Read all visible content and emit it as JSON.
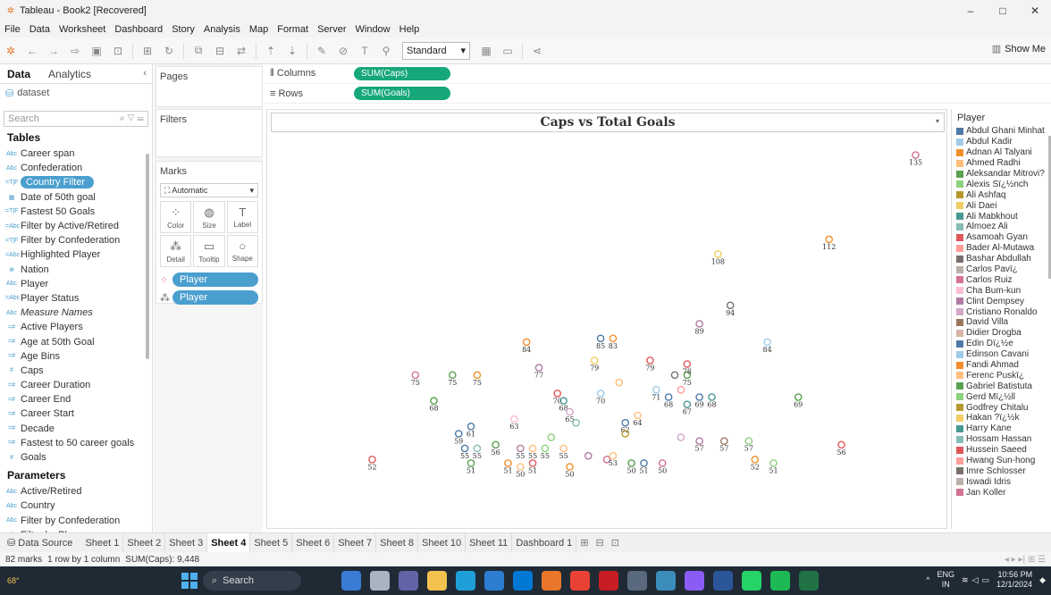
{
  "window": {
    "title": "Tableau - Book2 [Recovered]",
    "controls": [
      "–",
      "□",
      "✕"
    ]
  },
  "menu": [
    "File",
    "Data",
    "Worksheet",
    "Dashboard",
    "Story",
    "Analysis",
    "Map",
    "Format",
    "Server",
    "Window",
    "Help"
  ],
  "toolbar": {
    "fit_value": "Standard",
    "show_me": "Show Me"
  },
  "left_pane": {
    "tab_data": "Data",
    "tab_analytics": "Analytics",
    "datasource": "dataset",
    "search_placeholder": "Search",
    "tables_header": "Tables",
    "fields": [
      {
        "type": "Abc",
        "name": "Career span"
      },
      {
        "type": "Abc",
        "name": "Confederation"
      },
      {
        "type": "=T|F",
        "name": "Country Filter",
        "selected": true
      },
      {
        "type": "▦",
        "name": "Date of 50th goal"
      },
      {
        "type": "=T|F",
        "name": "Fastest 50 Goals"
      },
      {
        "type": "=Abc",
        "name": "Filter by Active/Retired"
      },
      {
        "type": "=T|F",
        "name": "Filter by Confederation"
      },
      {
        "type": "=Abc",
        "name": "Highlighted Player"
      },
      {
        "type": "⊕",
        "name": "Nation"
      },
      {
        "type": "Abc",
        "name": "Player"
      },
      {
        "type": "=Abc",
        "name": "Player Status"
      },
      {
        "type": "Abc",
        "name": "Measure Names",
        "italic": true
      },
      {
        "type": "=#",
        "name": "Active Players"
      },
      {
        "type": "=#",
        "name": "Age at 50th Goal"
      },
      {
        "type": "=#",
        "name": "Age Bins"
      },
      {
        "type": "#",
        "name": "Caps"
      },
      {
        "type": "=#",
        "name": "Career Duration"
      },
      {
        "type": "=#",
        "name": "Career End"
      },
      {
        "type": "=#",
        "name": "Career Start"
      },
      {
        "type": "=#",
        "name": "Decade"
      },
      {
        "type": "=#",
        "name": "Fastest to 50 career goals"
      },
      {
        "type": "#",
        "name": "Goals"
      }
    ],
    "parameters_header": "Parameters",
    "parameters": [
      {
        "type": "Abc",
        "name": "Active/Retired"
      },
      {
        "type": "Abc",
        "name": "Country"
      },
      {
        "type": "Abc",
        "name": "Filter by Confederation"
      },
      {
        "type": "#",
        "name": "Filter by Players"
      }
    ]
  },
  "cards": {
    "pages": "Pages",
    "filters": "Filters",
    "marks": "Marks",
    "marks_type": "Automatic",
    "mark_buttons": [
      {
        "icon": "color-icon",
        "glyph": "⁘",
        "label": "Color"
      },
      {
        "icon": "size-icon",
        "glyph": "◍",
        "label": "Size"
      },
      {
        "icon": "label-icon",
        "glyph": "T",
        "label": "Label"
      },
      {
        "icon": "detail-icon",
        "glyph": "⁂",
        "label": "Detail"
      },
      {
        "icon": "tooltip-icon",
        "glyph": "▭",
        "label": "Tooltip"
      },
      {
        "icon": "shape-icon",
        "glyph": "○",
        "label": "Shape"
      }
    ],
    "mark_pills": [
      "Player",
      "Player"
    ]
  },
  "shelves": {
    "columns_label": "Columns",
    "columns_pill": "SUM(Caps)",
    "rows_label": "Rows",
    "rows_pill": "SUM(Goals)"
  },
  "legend": {
    "title": "Player",
    "items": [
      {
        "name": "Abdul Ghani Minhat",
        "color": "#4e79a7"
      },
      {
        "name": "Abdul Kadir",
        "color": "#a0cbe8"
      },
      {
        "name": "Adnan Al Talyani",
        "color": "#f28e2b"
      },
      {
        "name": "Ahmed Radhi",
        "color": "#ffbe7d"
      },
      {
        "name": "Aleksandar Mitrovi?",
        "color": "#59a14f"
      },
      {
        "name": "Alexis Sï¿½nch",
        "color": "#8cd17d"
      },
      {
        "name": "Ali Ashfaq",
        "color": "#b6992d"
      },
      {
        "name": "Ali Daei",
        "color": "#f1ce63"
      },
      {
        "name": "Ali Mabkhout",
        "color": "#499894"
      },
      {
        "name": "Almoez Ali",
        "color": "#86bcb6"
      },
      {
        "name": "Asamoah Gyan",
        "color": "#e15759"
      },
      {
        "name": "Bader Al-Mutawa",
        "color": "#ff9d9a"
      },
      {
        "name": "Bashar Abdullah",
        "color": "#79706e"
      },
      {
        "name": "Carlos Pavï¿",
        "color": "#bab0ac"
      },
      {
        "name": "Carlos Ruiz",
        "color": "#d37295"
      },
      {
        "name": "Cha Bum-kun",
        "color": "#fabfd2"
      },
      {
        "name": "Clint Dempsey",
        "color": "#b07aa1"
      },
      {
        "name": "Cristiano Ronaldo",
        "color": "#d4a6c8"
      },
      {
        "name": "David Villa",
        "color": "#9d7660"
      },
      {
        "name": "Didier Drogba",
        "color": "#d7b5a6"
      },
      {
        "name": "Edin Dï¿½e",
        "color": "#4e79a7"
      },
      {
        "name": "Edinson Cavani",
        "color": "#a0cbe8"
      },
      {
        "name": "Fandi Ahmad",
        "color": "#f28e2b"
      },
      {
        "name": "Ferenc Puskï¿",
        "color": "#ffbe7d"
      },
      {
        "name": "Gabriel Batistuta",
        "color": "#59a14f"
      },
      {
        "name": "Gerd Mï¿½ll",
        "color": "#8cd17d"
      },
      {
        "name": "Godfrey Chitalu",
        "color": "#b6992d"
      },
      {
        "name": "Hakan ?ï¿½k",
        "color": "#f1ce63"
      },
      {
        "name": "Harry Kane",
        "color": "#499894"
      },
      {
        "name": "Hossam Hassan",
        "color": "#86bcb6"
      },
      {
        "name": "Hussein Saeed",
        "color": "#e15759"
      },
      {
        "name": "Hwang Sun-hong",
        "color": "#ff9d9a"
      },
      {
        "name": "Imre Schlosser",
        "color": "#79706e"
      },
      {
        "name": "Iswadi Idris",
        "color": "#bab0ac"
      },
      {
        "name": "Jan Koller",
        "color": "#d37295"
      }
    ]
  },
  "sheet_tabs": {
    "data_source": "Data Source",
    "tabs": [
      "Sheet 1",
      "Sheet 2",
      "Sheet 3",
      "Sheet 4",
      "Sheet 5",
      "Sheet 6",
      "Sheet 7",
      "Sheet 8",
      "Sheet 10",
      "Sheet 11",
      "Dashboard 1"
    ],
    "active": "Sheet 4"
  },
  "status": {
    "marks": "82 marks",
    "rows_cols": "1 row by 1 column",
    "sum": "SUM(Caps): 9,448"
  },
  "taskbar": {
    "weather": "68°",
    "search": "Search",
    "lang": "ENG",
    "region": "IN",
    "time": "10:56 PM",
    "date": "12/1/2024"
  },
  "chart_data": {
    "type": "scatter",
    "title": "Caps vs Total Goals",
    "xlabel": "",
    "ylabel": "",
    "show_axes": false,
    "grid": false,
    "xlim": [
      100,
      210
    ],
    "ylim": [
      45,
      140
    ],
    "marker": "open-circle",
    "labels_shown": true,
    "points": [
      {
        "x": 117,
        "y": 52,
        "label": "52",
        "color": "#e15759"
      },
      {
        "x": 124,
        "y": 75,
        "label": "75",
        "color": "#d37295"
      },
      {
        "x": 127,
        "y": 68,
        "label": "68",
        "color": "#59a14f"
      },
      {
        "x": 130,
        "y": 75,
        "label": "75",
        "color": "#59a14f"
      },
      {
        "x": 134,
        "y": 75,
        "label": "75",
        "color": "#f28e2b"
      },
      {
        "x": 131,
        "y": 59,
        "label": "59",
        "color": "#4e79a7"
      },
      {
        "x": 133,
        "y": 61,
        "label": "61",
        "color": "#4e79a7"
      },
      {
        "x": 132,
        "y": 55,
        "label": "55",
        "color": "#4e79a7"
      },
      {
        "x": 134,
        "y": 55,
        "label": "55",
        "color": "#86bcb6"
      },
      {
        "x": 133,
        "y": 51,
        "label": "51",
        "color": "#59a14f"
      },
      {
        "x": 137,
        "y": 56,
        "label": "56",
        "color": "#59a14f"
      },
      {
        "x": 140,
        "y": 63,
        "label": "63",
        "color": "#fabfd2"
      },
      {
        "x": 139,
        "y": 51,
        "label": "51",
        "color": "#f28e2b"
      },
      {
        "x": 141,
        "y": 50,
        "label": "50",
        "color": "#ffbe7d"
      },
      {
        "x": 141,
        "y": 55,
        "label": "55",
        "color": "#b07aa1"
      },
      {
        "x": 143,
        "y": 55,
        "label": "55",
        "color": "#ffbe7d"
      },
      {
        "x": 142,
        "y": 84,
        "label": "84",
        "color": "#f28e2b"
      },
      {
        "x": 143,
        "y": 51,
        "label": "51",
        "color": "#e15759"
      },
      {
        "x": 144,
        "y": 77,
        "label": "77",
        "color": "#b07aa1"
      },
      {
        "x": 145,
        "y": 55,
        "label": "55",
        "color": "#8cd17d"
      },
      {
        "x": 146,
        "y": 58,
        "label": "",
        "color": "#8cd17d"
      },
      {
        "x": 147,
        "y": 70,
        "label": "70",
        "color": "#e15759"
      },
      {
        "x": 148,
        "y": 68,
        "label": "68",
        "color": "#499894"
      },
      {
        "x": 149,
        "y": 65,
        "label": "65",
        "color": "#d4a6c8"
      },
      {
        "x": 148,
        "y": 55,
        "label": "55",
        "color": "#ffbe7d"
      },
      {
        "x": 149,
        "y": 50,
        "label": "50",
        "color": "#f28e2b"
      },
      {
        "x": 150,
        "y": 62,
        "label": "",
        "color": "#86bcb6"
      },
      {
        "x": 152,
        "y": 53,
        "label": "",
        "color": "#b07aa1"
      },
      {
        "x": 153,
        "y": 79,
        "label": "79",
        "color": "#f1ce63"
      },
      {
        "x": 154,
        "y": 70,
        "label": "70",
        "color": "#a0cbe8"
      },
      {
        "x": 154,
        "y": 85,
        "label": "85",
        "color": "#4e79a7"
      },
      {
        "x": 156,
        "y": 85,
        "label": "83",
        "color": "#f28e2b"
      },
      {
        "x": 155,
        "y": 52,
        "label": "",
        "color": "#d37295"
      },
      {
        "x": 156,
        "y": 53,
        "label": "53",
        "color": "#ffbe7d"
      },
      {
        "x": 157,
        "y": 73,
        "label": "",
        "color": "#ffbe7d"
      },
      {
        "x": 158,
        "y": 62,
        "label": "62",
        "color": "#4e79a7"
      },
      {
        "x": 158,
        "y": 59,
        "label": "",
        "color": "#b6992d"
      },
      {
        "x": 159,
        "y": 51,
        "label": "50",
        "color": "#59a14f"
      },
      {
        "x": 160,
        "y": 64,
        "label": "64",
        "color": "#ffbe7d"
      },
      {
        "x": 161,
        "y": 51,
        "label": "51",
        "color": "#4e79a7"
      },
      {
        "x": 162,
        "y": 79,
        "label": "79",
        "color": "#e15759"
      },
      {
        "x": 163,
        "y": 71,
        "label": "71",
        "color": "#a0cbe8"
      },
      {
        "x": 164,
        "y": 51,
        "label": "50",
        "color": "#d37295"
      },
      {
        "x": 165,
        "y": 69,
        "label": "68",
        "color": "#4e79a7"
      },
      {
        "x": 166,
        "y": 75,
        "label": "",
        "color": "#79706e"
      },
      {
        "x": 167,
        "y": 71,
        "label": "",
        "color": "#ff9d9a"
      },
      {
        "x": 168,
        "y": 67,
        "label": "67",
        "color": "#499894"
      },
      {
        "x": 168,
        "y": 75,
        "label": "75",
        "color": "#59a14f"
      },
      {
        "x": 168,
        "y": 78,
        "label": "78",
        "color": "#e15759"
      },
      {
        "x": 170,
        "y": 69,
        "label": "69",
        "color": "#4e79a7"
      },
      {
        "x": 172,
        "y": 69,
        "label": "68",
        "color": "#499894"
      },
      {
        "x": 170,
        "y": 89,
        "label": "89",
        "color": "#b07aa1"
      },
      {
        "x": 167,
        "y": 58,
        "label": "",
        "color": "#d4a6c8"
      },
      {
        "x": 170,
        "y": 57,
        "label": "57",
        "color": "#b07aa1"
      },
      {
        "x": 174,
        "y": 57,
        "label": "57",
        "color": "#9d7660"
      },
      {
        "x": 173,
        "y": 108,
        "label": "108",
        "color": "#f1ce63"
      },
      {
        "x": 175,
        "y": 94,
        "label": "94",
        "color": "#79706e"
      },
      {
        "x": 178,
        "y": 57,
        "label": "57",
        "color": "#8cd17d"
      },
      {
        "x": 179,
        "y": 52,
        "label": "52",
        "color": "#f28e2b"
      },
      {
        "x": 181,
        "y": 84,
        "label": "84",
        "color": "#a0cbe8"
      },
      {
        "x": 182,
        "y": 51,
        "label": "51",
        "color": "#8cd17d"
      },
      {
        "x": 186,
        "y": 69,
        "label": "69",
        "color": "#59a14f"
      },
      {
        "x": 191,
        "y": 112,
        "label": "112",
        "color": "#f28e2b"
      },
      {
        "x": 193,
        "y": 56,
        "label": "56",
        "color": "#e15759"
      },
      {
        "x": 205,
        "y": 135,
        "label": "135",
        "color": "#d37295"
      }
    ]
  }
}
